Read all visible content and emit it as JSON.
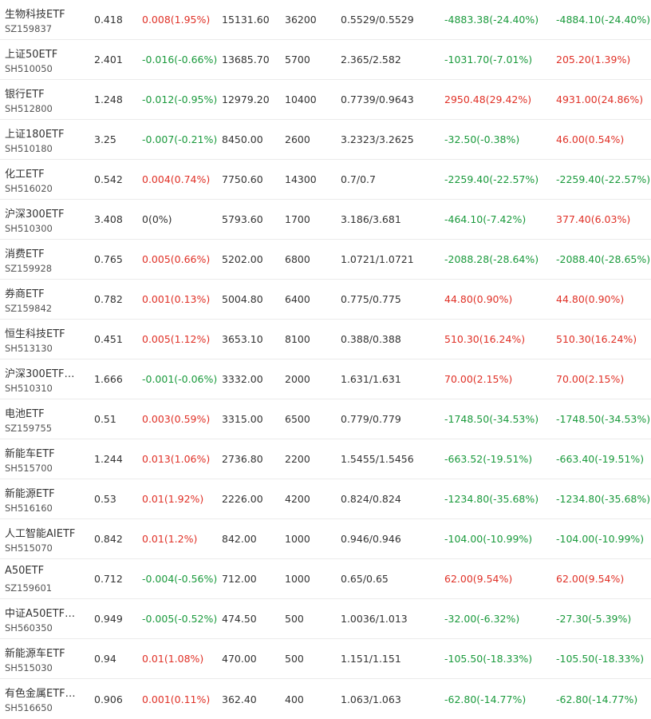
{
  "colors": {
    "up": "#e03127",
    "down": "#1a9a3c",
    "flat": "#333333"
  },
  "holdings": [
    {
      "name": "生物科技ETF",
      "code": "SZ159837",
      "price": "0.418",
      "change": "0.008(1.95%)",
      "change_dir": "up",
      "market_value": "15131.60",
      "quantity": "36200",
      "cost": "0.5529/0.5529",
      "pnl": "-4883.38(-24.40%)",
      "pnl_dir": "down",
      "pnl2": "-4884.10(-24.40%)",
      "pnl2_dir": "down"
    },
    {
      "name": "上证50ETF",
      "code": "SH510050",
      "price": "2.401",
      "change": "-0.016(-0.66%)",
      "change_dir": "down",
      "market_value": "13685.70",
      "quantity": "5700",
      "cost": "2.365/2.582",
      "pnl": "-1031.70(-7.01%)",
      "pnl_dir": "down",
      "pnl2": "205.20(1.39%)",
      "pnl2_dir": "up"
    },
    {
      "name": "银行ETF",
      "code": "SH512800",
      "price": "1.248",
      "change": "-0.012(-0.95%)",
      "change_dir": "down",
      "market_value": "12979.20",
      "quantity": "10400",
      "cost": "0.7739/0.9643",
      "pnl": "2950.48(29.42%)",
      "pnl_dir": "up",
      "pnl2": "4931.00(24.86%)",
      "pnl2_dir": "up"
    },
    {
      "name": "上证180ETF",
      "code": "SH510180",
      "price": "3.25",
      "change": "-0.007(-0.21%)",
      "change_dir": "down",
      "market_value": "8450.00",
      "quantity": "2600",
      "cost": "3.2323/3.2625",
      "pnl": "-32.50(-0.38%)",
      "pnl_dir": "down",
      "pnl2": "46.00(0.54%)",
      "pnl2_dir": "up"
    },
    {
      "name": "化工ETF",
      "code": "SH516020",
      "price": "0.542",
      "change": "0.004(0.74%)",
      "change_dir": "up",
      "market_value": "7750.60",
      "quantity": "14300",
      "cost": "0.7/0.7",
      "pnl": "-2259.40(-22.57%)",
      "pnl_dir": "down",
      "pnl2": "-2259.40(-22.57%)",
      "pnl2_dir": "down"
    },
    {
      "name": "沪深300ETF",
      "code": "SH510300",
      "price": "3.408",
      "change": "0(0%)",
      "change_dir": "flat",
      "market_value": "5793.60",
      "quantity": "1700",
      "cost": "3.186/3.681",
      "pnl": "-464.10(-7.42%)",
      "pnl_dir": "down",
      "pnl2": "377.40(6.03%)",
      "pnl2_dir": "up"
    },
    {
      "name": "消费ETF",
      "code": "SZ159928",
      "price": "0.765",
      "change": "0.005(0.66%)",
      "change_dir": "up",
      "market_value": "5202.00",
      "quantity": "6800",
      "cost": "1.0721/1.0721",
      "pnl": "-2088.28(-28.64%)",
      "pnl_dir": "down",
      "pnl2": "-2088.40(-28.65%)",
      "pnl2_dir": "down"
    },
    {
      "name": "券商ETF",
      "code": "SZ159842",
      "price": "0.782",
      "change": "0.001(0.13%)",
      "change_dir": "up",
      "market_value": "5004.80",
      "quantity": "6400",
      "cost": "0.775/0.775",
      "pnl": "44.80(0.90%)",
      "pnl_dir": "up",
      "pnl2": "44.80(0.90%)",
      "pnl2_dir": "up"
    },
    {
      "name": "恒生科技ETF",
      "code": "SH513130",
      "price": "0.451",
      "change": "0.005(1.12%)",
      "change_dir": "up",
      "market_value": "3653.10",
      "quantity": "8100",
      "cost": "0.388/0.388",
      "pnl": "510.30(16.24%)",
      "pnl_dir": "up",
      "pnl2": "510.30(16.24%)",
      "pnl2_dir": "up"
    },
    {
      "name": "沪深300ETF…",
      "code": "SH510310",
      "price": "1.666",
      "change": "-0.001(-0.06%)",
      "change_dir": "down",
      "market_value": "3332.00",
      "quantity": "2000",
      "cost": "1.631/1.631",
      "pnl": "70.00(2.15%)",
      "pnl_dir": "up",
      "pnl2": "70.00(2.15%)",
      "pnl2_dir": "up"
    },
    {
      "name": "电池ETF",
      "code": "SZ159755",
      "price": "0.51",
      "change": "0.003(0.59%)",
      "change_dir": "up",
      "market_value": "3315.00",
      "quantity": "6500",
      "cost": "0.779/0.779",
      "pnl": "-1748.50(-34.53%)",
      "pnl_dir": "down",
      "pnl2": "-1748.50(-34.53%)",
      "pnl2_dir": "down"
    },
    {
      "name": "新能车ETF",
      "code": "SH515700",
      "price": "1.244",
      "change": "0.013(1.06%)",
      "change_dir": "up",
      "market_value": "2736.80",
      "quantity": "2200",
      "cost": "1.5455/1.5456",
      "pnl": "-663.52(-19.51%)",
      "pnl_dir": "down",
      "pnl2": "-663.40(-19.51%)",
      "pnl2_dir": "down"
    },
    {
      "name": "新能源ETF",
      "code": "SH516160",
      "price": "0.53",
      "change": "0.01(1.92%)",
      "change_dir": "up",
      "market_value": "2226.00",
      "quantity": "4200",
      "cost": "0.824/0.824",
      "pnl": "-1234.80(-35.68%)",
      "pnl_dir": "down",
      "pnl2": "-1234.80(-35.68%)",
      "pnl2_dir": "down"
    },
    {
      "name": "人工智能AIETF",
      "code": "SH515070",
      "price": "0.842",
      "change": "0.01(1.2%)",
      "change_dir": "up",
      "market_value": "842.00",
      "quantity": "1000",
      "cost": "0.946/0.946",
      "pnl": "-104.00(-10.99%)",
      "pnl_dir": "down",
      "pnl2": "-104.00(-10.99%)",
      "pnl2_dir": "down"
    },
    {
      "name": "A50ETF",
      "code": "SZ159601",
      "price": "0.712",
      "change": "-0.004(-0.56%)",
      "change_dir": "down",
      "market_value": "712.00",
      "quantity": "1000",
      "cost": "0.65/0.65",
      "pnl": "62.00(9.54%)",
      "pnl_dir": "up",
      "pnl2": "62.00(9.54%)",
      "pnl2_dir": "up"
    },
    {
      "name": "中证A50ETF…",
      "code": "SH560350",
      "price": "0.949",
      "change": "-0.005(-0.52%)",
      "change_dir": "down",
      "market_value": "474.50",
      "quantity": "500",
      "cost": "1.0036/1.013",
      "pnl": "-32.00(-6.32%)",
      "pnl_dir": "down",
      "pnl2": "-27.30(-5.39%)",
      "pnl2_dir": "down"
    },
    {
      "name": "新能源车ETF",
      "code": "SH515030",
      "price": "0.94",
      "change": "0.01(1.08%)",
      "change_dir": "up",
      "market_value": "470.00",
      "quantity": "500",
      "cost": "1.151/1.151",
      "pnl": "-105.50(-18.33%)",
      "pnl_dir": "down",
      "pnl2": "-105.50(-18.33%)",
      "pnl2_dir": "down"
    },
    {
      "name": "有色金属ETF…",
      "code": "SH516650",
      "price": "0.906",
      "change": "0.001(0.11%)",
      "change_dir": "up",
      "market_value": "362.40",
      "quantity": "400",
      "cost": "1.063/1.063",
      "pnl": "-62.80(-14.77%)",
      "pnl_dir": "down",
      "pnl2": "-62.80(-14.77%)",
      "pnl2_dir": "down"
    }
  ]
}
